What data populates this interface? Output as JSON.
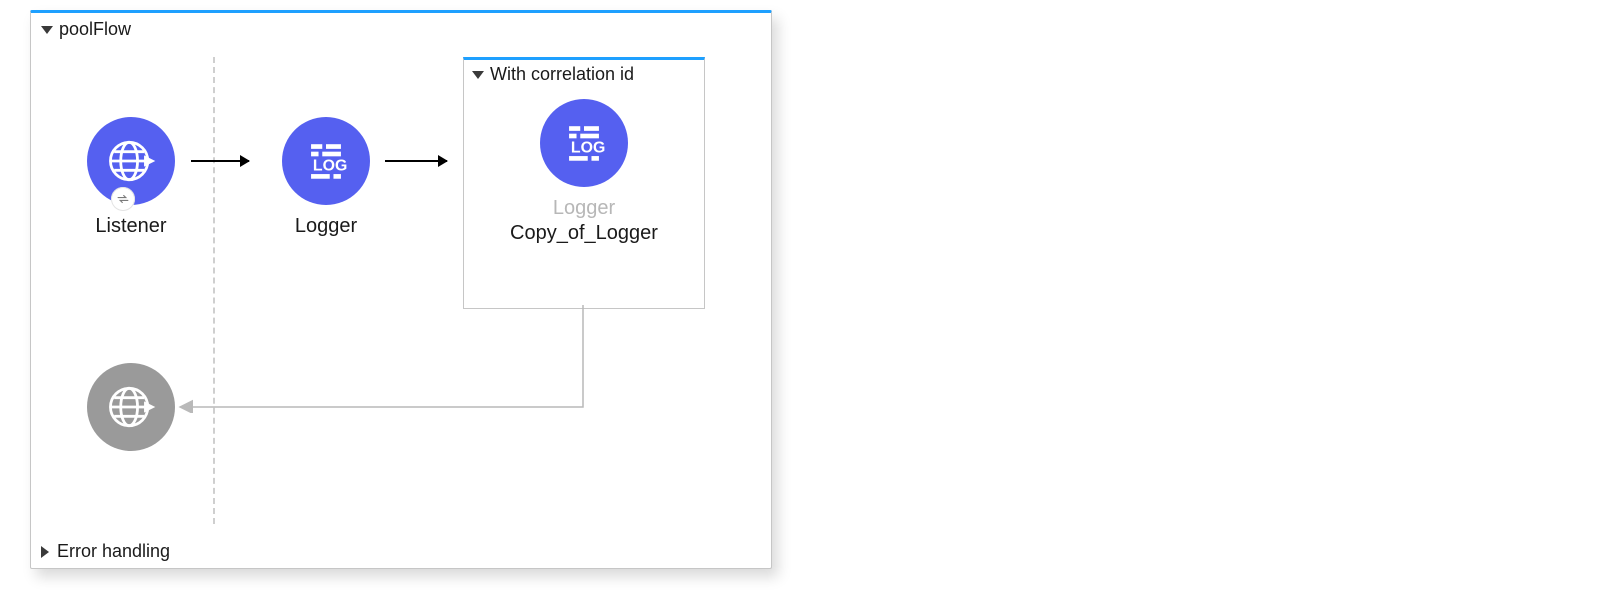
{
  "flow": {
    "title": "poolFlow",
    "sections": {
      "error_handling": "Error handling"
    },
    "nodes": {
      "listener": {
        "label": "Listener"
      },
      "logger": {
        "label": "Logger"
      },
      "scope": {
        "title": "With correlation id",
        "inner_type": "Logger",
        "inner_name": "Copy_of_Logger"
      }
    },
    "icons": {
      "listener": "globe-arrow-icon",
      "logger": "log-brick-icon",
      "response": "globe-arrow-icon"
    }
  }
}
